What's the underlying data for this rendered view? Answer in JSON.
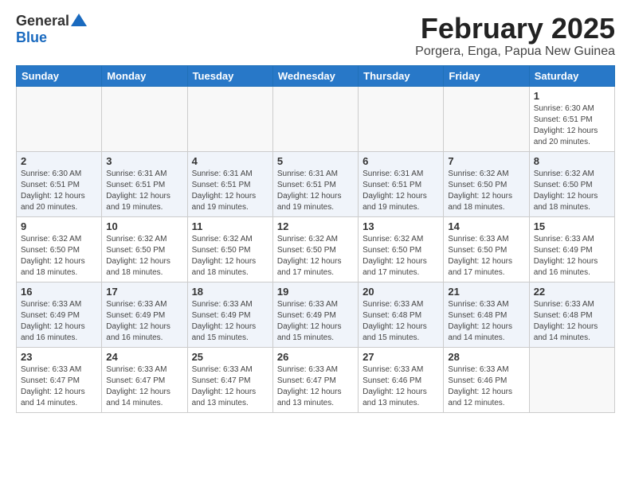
{
  "logo": {
    "general": "General",
    "blue": "Blue"
  },
  "title": {
    "month": "February 2025",
    "location": "Porgera, Enga, Papua New Guinea"
  },
  "days_header": [
    "Sunday",
    "Monday",
    "Tuesday",
    "Wednesday",
    "Thursday",
    "Friday",
    "Saturday"
  ],
  "weeks": [
    [
      {
        "day": "",
        "info": ""
      },
      {
        "day": "",
        "info": ""
      },
      {
        "day": "",
        "info": ""
      },
      {
        "day": "",
        "info": ""
      },
      {
        "day": "",
        "info": ""
      },
      {
        "day": "",
        "info": ""
      },
      {
        "day": "1",
        "info": "Sunrise: 6:30 AM\nSunset: 6:51 PM\nDaylight: 12 hours\nand 20 minutes."
      }
    ],
    [
      {
        "day": "2",
        "info": "Sunrise: 6:30 AM\nSunset: 6:51 PM\nDaylight: 12 hours\nand 20 minutes."
      },
      {
        "day": "3",
        "info": "Sunrise: 6:31 AM\nSunset: 6:51 PM\nDaylight: 12 hours\nand 19 minutes."
      },
      {
        "day": "4",
        "info": "Sunrise: 6:31 AM\nSunset: 6:51 PM\nDaylight: 12 hours\nand 19 minutes."
      },
      {
        "day": "5",
        "info": "Sunrise: 6:31 AM\nSunset: 6:51 PM\nDaylight: 12 hours\nand 19 minutes."
      },
      {
        "day": "6",
        "info": "Sunrise: 6:31 AM\nSunset: 6:51 PM\nDaylight: 12 hours\nand 19 minutes."
      },
      {
        "day": "7",
        "info": "Sunrise: 6:32 AM\nSunset: 6:50 PM\nDaylight: 12 hours\nand 18 minutes."
      },
      {
        "day": "8",
        "info": "Sunrise: 6:32 AM\nSunset: 6:50 PM\nDaylight: 12 hours\nand 18 minutes."
      }
    ],
    [
      {
        "day": "9",
        "info": "Sunrise: 6:32 AM\nSunset: 6:50 PM\nDaylight: 12 hours\nand 18 minutes."
      },
      {
        "day": "10",
        "info": "Sunrise: 6:32 AM\nSunset: 6:50 PM\nDaylight: 12 hours\nand 18 minutes."
      },
      {
        "day": "11",
        "info": "Sunrise: 6:32 AM\nSunset: 6:50 PM\nDaylight: 12 hours\nand 18 minutes."
      },
      {
        "day": "12",
        "info": "Sunrise: 6:32 AM\nSunset: 6:50 PM\nDaylight: 12 hours\nand 17 minutes."
      },
      {
        "day": "13",
        "info": "Sunrise: 6:32 AM\nSunset: 6:50 PM\nDaylight: 12 hours\nand 17 minutes."
      },
      {
        "day": "14",
        "info": "Sunrise: 6:33 AM\nSunset: 6:50 PM\nDaylight: 12 hours\nand 17 minutes."
      },
      {
        "day": "15",
        "info": "Sunrise: 6:33 AM\nSunset: 6:49 PM\nDaylight: 12 hours\nand 16 minutes."
      }
    ],
    [
      {
        "day": "16",
        "info": "Sunrise: 6:33 AM\nSunset: 6:49 PM\nDaylight: 12 hours\nand 16 minutes."
      },
      {
        "day": "17",
        "info": "Sunrise: 6:33 AM\nSunset: 6:49 PM\nDaylight: 12 hours\nand 16 minutes."
      },
      {
        "day": "18",
        "info": "Sunrise: 6:33 AM\nSunset: 6:49 PM\nDaylight: 12 hours\nand 15 minutes."
      },
      {
        "day": "19",
        "info": "Sunrise: 6:33 AM\nSunset: 6:49 PM\nDaylight: 12 hours\nand 15 minutes."
      },
      {
        "day": "20",
        "info": "Sunrise: 6:33 AM\nSunset: 6:48 PM\nDaylight: 12 hours\nand 15 minutes."
      },
      {
        "day": "21",
        "info": "Sunrise: 6:33 AM\nSunset: 6:48 PM\nDaylight: 12 hours\nand 14 minutes."
      },
      {
        "day": "22",
        "info": "Sunrise: 6:33 AM\nSunset: 6:48 PM\nDaylight: 12 hours\nand 14 minutes."
      }
    ],
    [
      {
        "day": "23",
        "info": "Sunrise: 6:33 AM\nSunset: 6:47 PM\nDaylight: 12 hours\nand 14 minutes."
      },
      {
        "day": "24",
        "info": "Sunrise: 6:33 AM\nSunset: 6:47 PM\nDaylight: 12 hours\nand 14 minutes."
      },
      {
        "day": "25",
        "info": "Sunrise: 6:33 AM\nSunset: 6:47 PM\nDaylight: 12 hours\nand 13 minutes."
      },
      {
        "day": "26",
        "info": "Sunrise: 6:33 AM\nSunset: 6:47 PM\nDaylight: 12 hours\nand 13 minutes."
      },
      {
        "day": "27",
        "info": "Sunrise: 6:33 AM\nSunset: 6:46 PM\nDaylight: 12 hours\nand 13 minutes."
      },
      {
        "day": "28",
        "info": "Sunrise: 6:33 AM\nSunset: 6:46 PM\nDaylight: 12 hours\nand 12 minutes."
      },
      {
        "day": "",
        "info": ""
      }
    ]
  ]
}
